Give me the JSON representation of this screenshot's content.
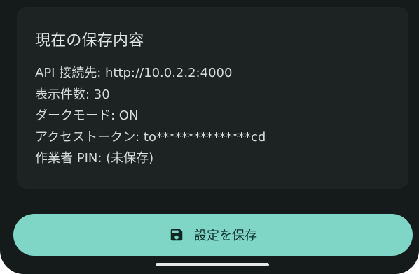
{
  "card": {
    "title": "現在の保存内容",
    "lines": [
      "API 接続先: http://10.0.2.2:4000",
      "表示件数: 30",
      "ダークモード: ON",
      "アクセストークン: to***************cd",
      "作業者 PIN: (未保存)"
    ]
  },
  "save_button": {
    "label": "設定を保存",
    "icon": "save-icon"
  },
  "colors": {
    "background": "#151b1a",
    "card": "#1d2322",
    "accent": "#7fd6c7"
  }
}
